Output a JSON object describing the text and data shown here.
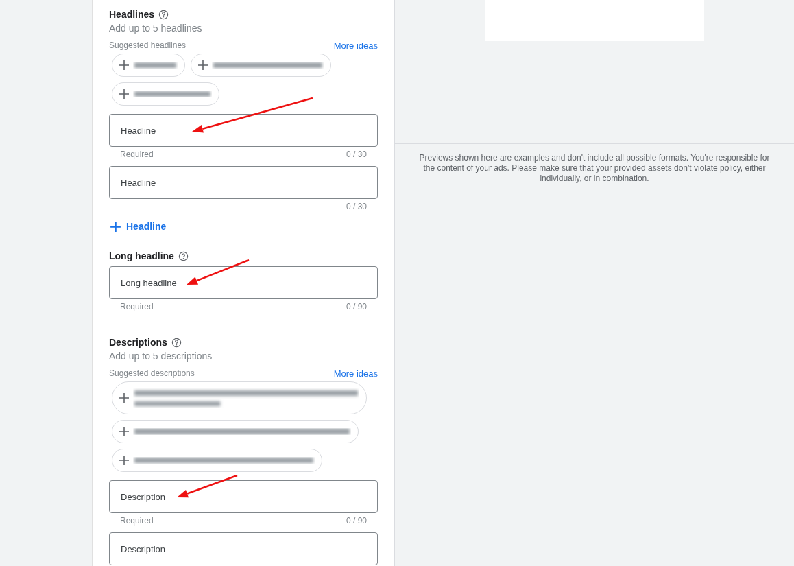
{
  "sections": [
    {
      "kind": "suggested",
      "title": "Headlines",
      "subtitle": "Add up to 5 headlines",
      "suggested_label": "Suggested headlines",
      "more_link": "More ideas",
      "suggestions": [
        {
          "kind": "one-line"
        },
        {
          "kind": "one-line"
        },
        {
          "kind": "one-line"
        }
      ],
      "fields": [
        {
          "placeholder": "Headline",
          "helper": "Required",
          "counter": "0 / 30"
        },
        {
          "placeholder": "Headline",
          "counter": "0 / 30"
        }
      ],
      "add_button": "Headline"
    },
    {
      "kind": "single",
      "title": "Long headline",
      "fields": [
        {
          "placeholder": "Long headline",
          "helper": "Required",
          "counter": "0 / 90"
        }
      ]
    },
    {
      "kind": "suggested",
      "title": "Descriptions",
      "subtitle": "Add up to 5 descriptions",
      "suggested_label": "Suggested descriptions",
      "more_link": "More ideas",
      "suggestions": [
        {
          "kind": "two-line"
        },
        {
          "kind": "one-line"
        },
        {
          "kind": "one-line"
        }
      ],
      "fields": [
        {
          "placeholder": "Description",
          "helper": "Required",
          "counter": "0 / 90"
        },
        {
          "placeholder": "Description"
        }
      ]
    }
  ],
  "preview": {
    "notice": "Previews shown here are examples and don't include all possible formats. You're responsible for the content of your ads. Please make sure that your provided assets don't violate policy, either individually, or in combination."
  },
  "annotations": [
    {
      "kind": "arrow"
    },
    {
      "kind": "arrow"
    },
    {
      "kind": "arrow"
    }
  ]
}
